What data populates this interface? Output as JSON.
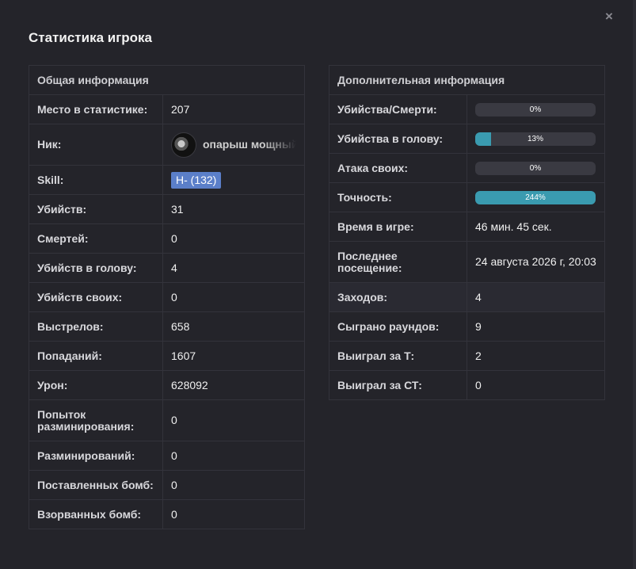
{
  "modal": {
    "title": "Статистика игрока",
    "close_icon": "close-icon",
    "close_glyph": "×"
  },
  "left": {
    "header": "Общая информация",
    "rows": [
      {
        "label": "Место в статистике:",
        "value": "207"
      },
      {
        "label": "Ник:",
        "value": "опарыш мощный",
        "avatar_icon": "avatar-icon"
      },
      {
        "label": "Skill:",
        "value": "H- (132)",
        "badge_color": "#5b7fc9"
      },
      {
        "label": "Убийств:",
        "value": "31"
      },
      {
        "label": "Смертей:",
        "value": "0"
      },
      {
        "label": "Убийств в голову:",
        "value": "4"
      },
      {
        "label": "Убийств своих:",
        "value": "0"
      },
      {
        "label": "Выстрелов:",
        "value": "658"
      },
      {
        "label": "Попаданий:",
        "value": "1607"
      },
      {
        "label": "Урон:",
        "value": "628092"
      },
      {
        "label": "Попыток разминирования:",
        "value": "0"
      },
      {
        "label": "Разминирований:",
        "value": "0"
      },
      {
        "label": "Поставленных бомб:",
        "value": "0"
      },
      {
        "label": "Взорванных бомб:",
        "value": "0"
      }
    ]
  },
  "right": {
    "header": "Дополнительная информация",
    "rows": [
      {
        "label": "Убийства/Смерти:",
        "value": "0%",
        "progress": 0
      },
      {
        "label": "Убийства в голову:",
        "value": "13%",
        "progress": 13
      },
      {
        "label": "Атака своих:",
        "value": "0%",
        "progress": 0
      },
      {
        "label": "Точность:",
        "value": "244%",
        "progress": 100
      },
      {
        "label": "Время в игре:",
        "value": "46 мин. 45 сек."
      },
      {
        "label": "Последнее посещение:",
        "value": "24 августа 2026 г, 20:03"
      },
      {
        "label": "Заходов:",
        "value": "4"
      },
      {
        "label": "Сыграно раундов:",
        "value": "9"
      },
      {
        "label": "Выиграл за Т:",
        "value": "2"
      },
      {
        "label": "Выиграл за СТ:",
        "value": "0"
      }
    ]
  },
  "colors": {
    "background": "#24242a",
    "progress_fill": "#3a9bb0",
    "progress_track": "#3a3a42",
    "skill_badge": "#5b7fc9"
  }
}
